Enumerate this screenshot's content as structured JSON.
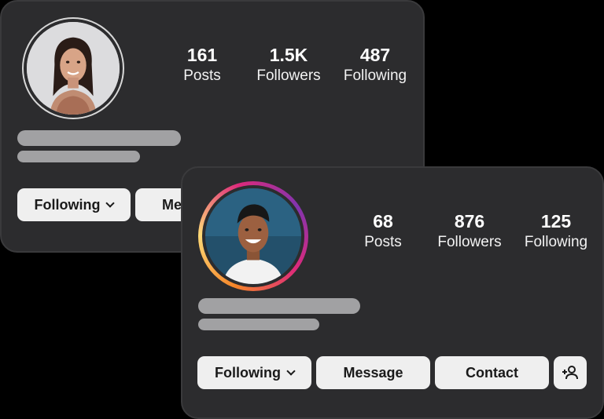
{
  "colors": {
    "card_background": "#2c2c2e",
    "button_background": "#efefef",
    "skeleton": "#a1a1a3",
    "story_ring": "#dd2a7b"
  },
  "profile_back": {
    "stats": [
      {
        "value": "161",
        "label": "Posts"
      },
      {
        "value": "1.5K",
        "label": "Followers"
      },
      {
        "value": "487",
        "label": "Following"
      }
    ],
    "buttons": {
      "following": "Following",
      "message": "Message"
    }
  },
  "profile_front": {
    "stats": [
      {
        "value": "68",
        "label": "Posts"
      },
      {
        "value": "876",
        "label": "Followers"
      },
      {
        "value": "125",
        "label": "Following"
      }
    ],
    "buttons": {
      "following": "Following",
      "message": "Message",
      "contact": "Contact"
    }
  }
}
